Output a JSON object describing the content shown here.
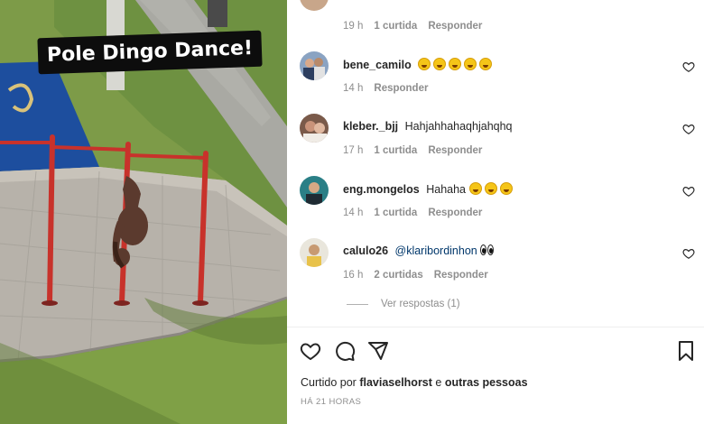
{
  "media": {
    "caption_tag": "Pole Dingo Dance!"
  },
  "comments": [
    {
      "username": "",
      "text": "",
      "time": "19 h",
      "likes": "1 curtida",
      "reply": "Responder",
      "emoji_count": 0
    },
    {
      "username": "bene_camilo",
      "text": "",
      "time": "14 h",
      "likes": "",
      "reply": "Responder",
      "emoji_count": 5
    },
    {
      "username": "kleber._bjj",
      "text": "Hahjahhahaqhjahqhq",
      "time": "17 h",
      "likes": "1 curtida",
      "reply": "Responder",
      "emoji_count": 0
    },
    {
      "username": "eng.mongelos",
      "text": "Hahaha",
      "time": "14 h",
      "likes": "1 curtida",
      "reply": "Responder",
      "emoji_count": 3
    },
    {
      "username": "calulo26",
      "text": "@klaribordinhon",
      "time": "16 h",
      "likes": "2 curtidas",
      "reply": "Responder",
      "emoji_count": 0
    }
  ],
  "view_replies": "Ver respostas (1)",
  "footer": {
    "liked_prefix": "Curtido por",
    "liked_user": "flaviaselhorst",
    "liked_connector": "e",
    "liked_others": "outras pessoas",
    "timestamp": "HÁ 21 HORAS"
  },
  "icons": {
    "like": "heart-icon",
    "comment": "comment-bubble-icon",
    "share": "paper-plane-icon",
    "save": "bookmark-icon"
  },
  "colors": {
    "text": "#262626",
    "secondary": "#8e8e8e",
    "mention": "#00376b",
    "tag_bg": "#0d0d0d"
  }
}
